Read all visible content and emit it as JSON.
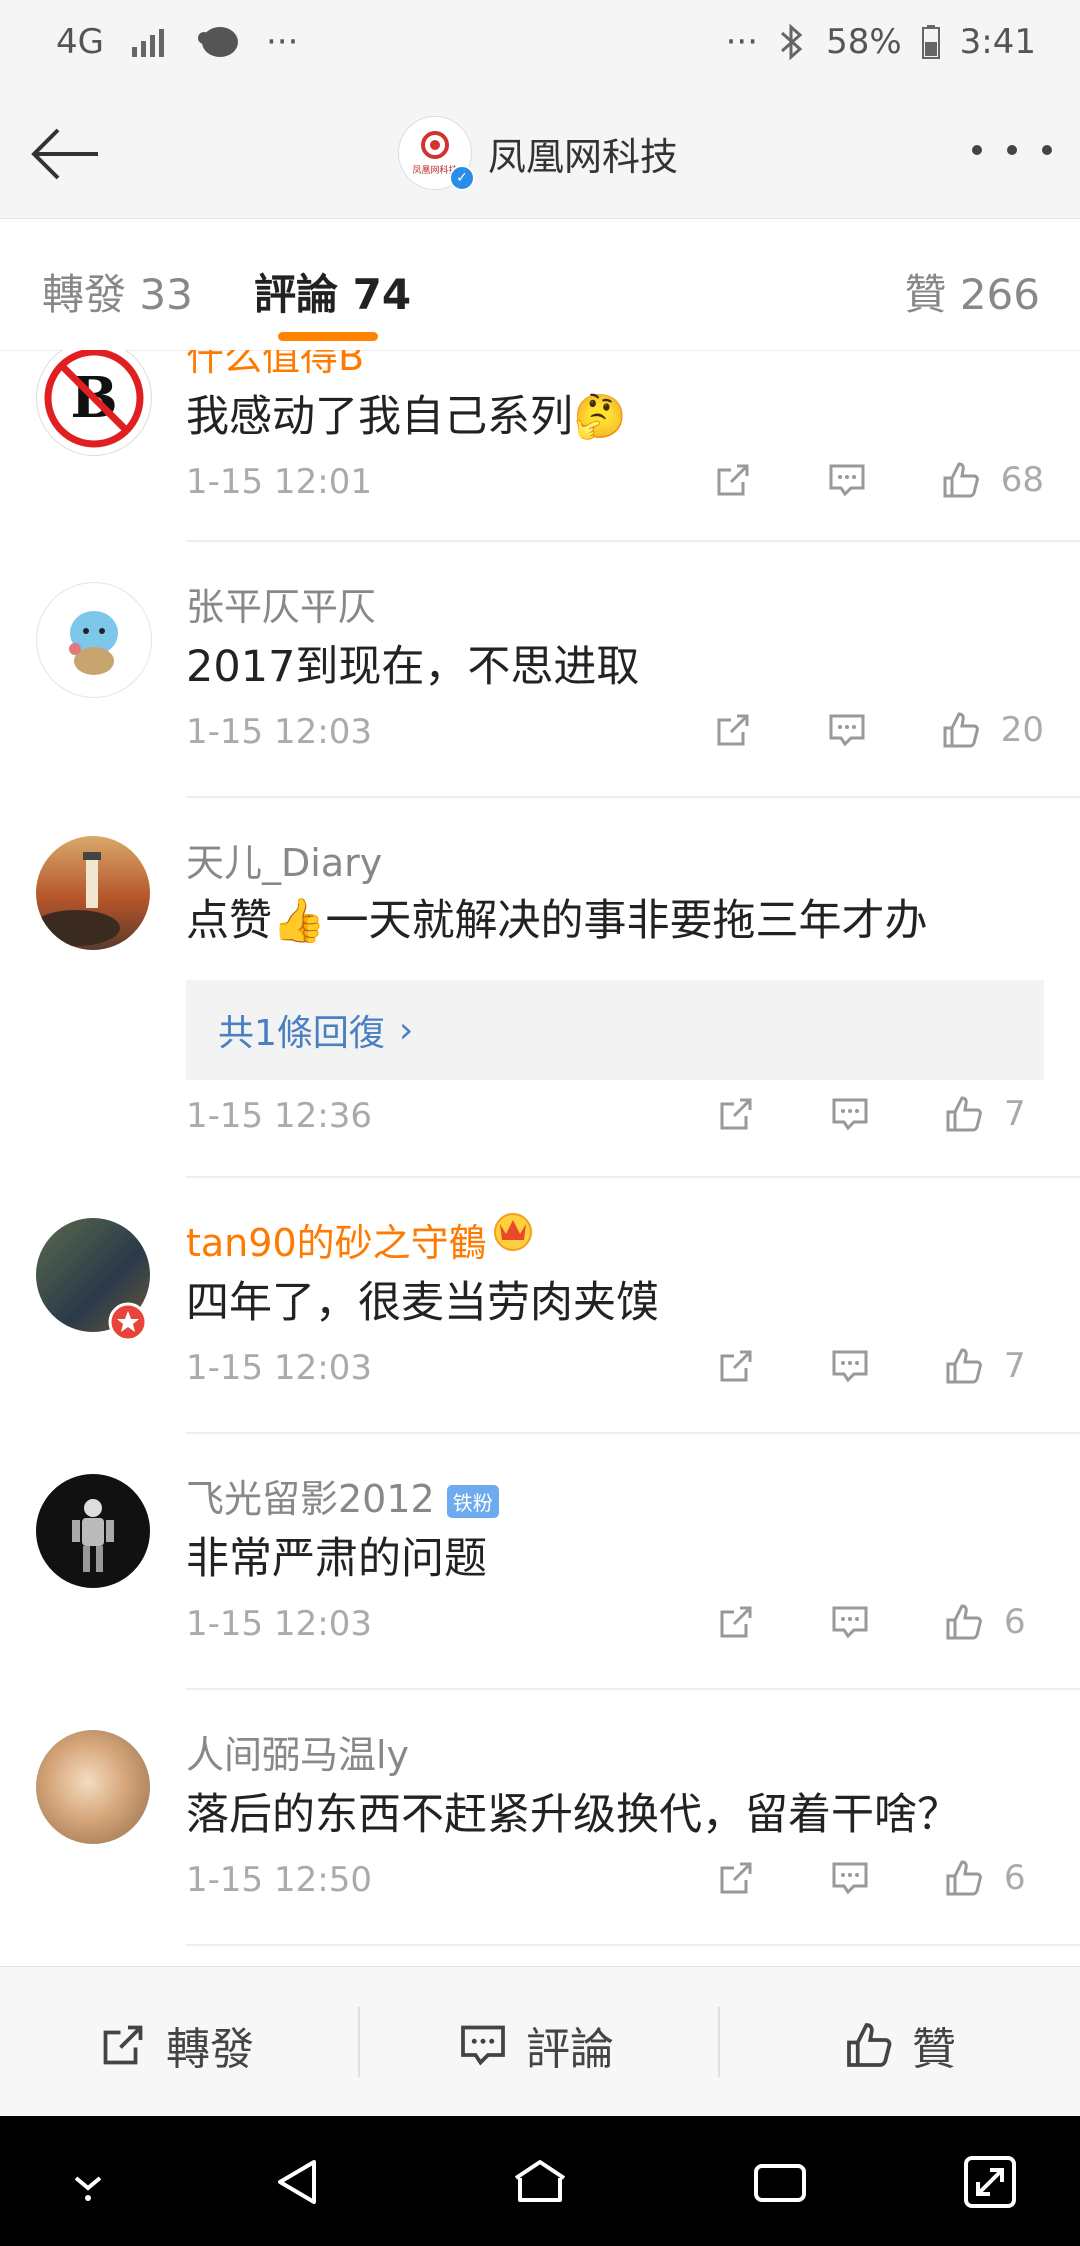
{
  "status_bar": {
    "network": "4G",
    "more": "···",
    "more_right": "···",
    "battery": "58%",
    "time": "3:41"
  },
  "header": {
    "title": "凤凰网科技",
    "logo_text": "凤凰网科技"
  },
  "tabs": {
    "reposts": "轉發 33",
    "comments": "評論 74",
    "likes": "贊 266"
  },
  "comments": [
    {
      "name": "什么值得B",
      "text": "我感动了我自己系列🤔",
      "time": "1-15 12:01",
      "likes": "68"
    },
    {
      "name": "张平仄平仄",
      "text": "2017到现在，不思进取",
      "time": "1-15 12:03",
      "likes": "20"
    },
    {
      "name": "天儿_Diary",
      "text": "点赞👍一天就解决的事非要拖三年才办",
      "reply_link": "共1條回復",
      "time": "1-15 12:36",
      "likes": "7"
    },
    {
      "name": "tan90的砂之守鶴",
      "text": "四年了，很麦当劳肉夹馍",
      "time": "1-15 12:03",
      "likes": "7"
    },
    {
      "name": "飞光留影2012",
      "badge": "铁粉",
      "text": "非常严肃的问题",
      "time": "1-15 12:03",
      "likes": "6"
    },
    {
      "name": "人间弼马温ly",
      "text": "落后的东西不赶紧升级换代，留着干啥？",
      "time": "1-15 12:50",
      "likes": "6"
    }
  ],
  "bottom_bar": {
    "repost": "轉發",
    "comment": "評論",
    "like": "贊"
  },
  "colors": {
    "accent": "#ff8200",
    "link": "#4a80c2",
    "orange_name": "#ff7a00",
    "meta": "#aaaaaa"
  }
}
